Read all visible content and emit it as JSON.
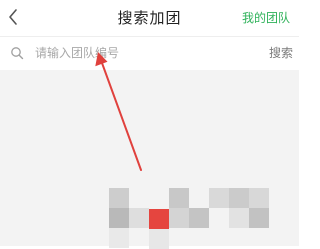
{
  "header": {
    "back_icon": "chevron-left-icon",
    "title": "搜索加团",
    "my_team_label": "我的团队"
  },
  "search": {
    "icon": "search-icon",
    "placeholder": "请输入团队编号",
    "value": "",
    "button_label": "搜索"
  },
  "colors": {
    "accent_green": "#2fb25a",
    "arrow_red": "#e0413d",
    "mosaic_red": "#e5453f"
  }
}
